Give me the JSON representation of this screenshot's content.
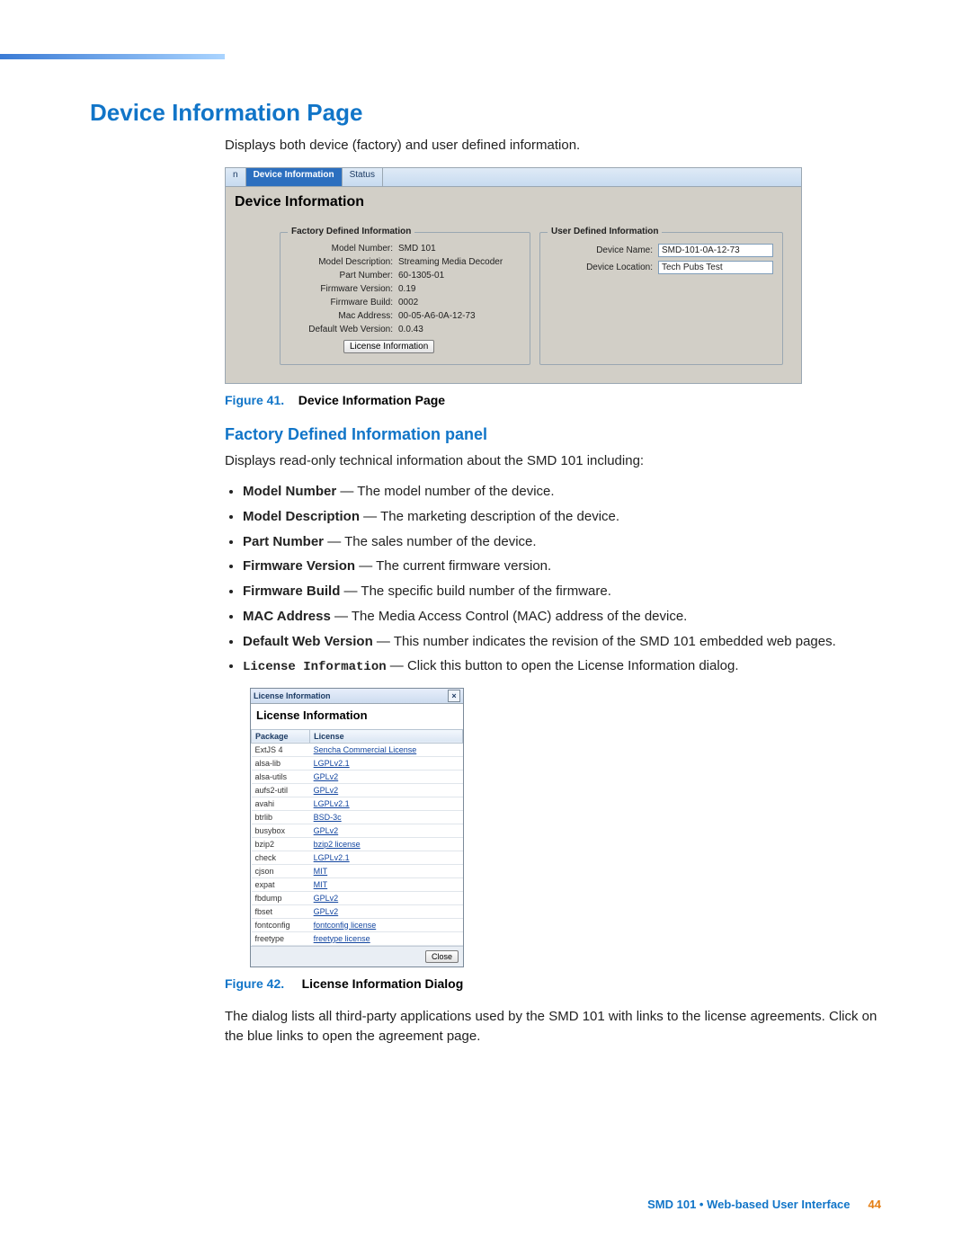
{
  "heading": "Device Information Page",
  "intro": "Displays both device (factory) and user defined information.",
  "fig41": {
    "label": "Figure 41.",
    "title": "Device Information Page"
  },
  "deviceInfo": {
    "tabs": {
      "stub": "n",
      "active": "Device Information",
      "other": "Status"
    },
    "panelTitle": "Device Information",
    "factory": {
      "legend": "Factory Defined Information",
      "rows": [
        {
          "k": "Model Number:",
          "v": "SMD 101"
        },
        {
          "k": "Model Description:",
          "v": "Streaming Media Decoder"
        },
        {
          "k": "Part Number:",
          "v": "60-1305-01"
        },
        {
          "k": "Firmware Version:",
          "v": "0.19"
        },
        {
          "k": "Firmware Build:",
          "v": "0002"
        },
        {
          "k": "Mac Address:",
          "v": "00-05-A6-0A-12-73"
        },
        {
          "k": "Default Web Version:",
          "v": "0.0.43"
        }
      ],
      "licenseBtn": "License Information"
    },
    "user": {
      "legend": "User Defined Information",
      "rows": [
        {
          "k": "Device Name:",
          "v": "SMD-101-0A-12-73"
        },
        {
          "k": "Device Location:",
          "v": "Tech Pubs Test"
        }
      ]
    }
  },
  "subsection": "Factory Defined Information panel",
  "subIntro": "Displays read-only technical information about the SMD 101 including:",
  "descList": [
    {
      "term": "Model Number",
      "desc": " — The model number of the device."
    },
    {
      "term": "Model Description",
      "desc": " — The marketing description of the device."
    },
    {
      "term": "Part Number",
      "desc": " — The sales number of the device."
    },
    {
      "term": "Firmware Version",
      "desc": " — The current firmware version."
    },
    {
      "term": "Firmware Build",
      "desc": " — The specific build number of the firmware."
    },
    {
      "term": "MAC Address",
      "desc": " — The Media Access Control (MAC) address of the device."
    },
    {
      "term": "Default Web Version",
      "desc": " — This number indicates the revision of the SMD 101 embedded web pages."
    },
    {
      "term": "License Information",
      "desc": " — Click this button to open the License Information dialog.",
      "mono": true
    }
  ],
  "licenseDialog": {
    "title": "License Information",
    "heading": "License Information",
    "headers": {
      "pkg": "Package",
      "lic": "License"
    },
    "rows": [
      {
        "pkg": "ExtJS 4",
        "lic": "Sencha Commercial License"
      },
      {
        "pkg": "alsa-lib",
        "lic": "LGPLv2.1"
      },
      {
        "pkg": "alsa-utils",
        "lic": "GPLv2"
      },
      {
        "pkg": "aufs2-util",
        "lic": "GPLv2"
      },
      {
        "pkg": "avahi",
        "lic": "LGPLv2.1"
      },
      {
        "pkg": "btrlib",
        "lic": "BSD-3c"
      },
      {
        "pkg": "busybox",
        "lic": "GPLv2"
      },
      {
        "pkg": "bzip2",
        "lic": "bzip2 license"
      },
      {
        "pkg": "check",
        "lic": "LGPLv2.1"
      },
      {
        "pkg": "cjson",
        "lic": "MIT"
      },
      {
        "pkg": "expat",
        "lic": "MIT"
      },
      {
        "pkg": "fbdump",
        "lic": "GPLv2"
      },
      {
        "pkg": "fbset",
        "lic": "GPLv2"
      },
      {
        "pkg": "fontconfig",
        "lic": "fontconfig license"
      },
      {
        "pkg": "freetype",
        "lic": "freetype license"
      }
    ],
    "close": "Close"
  },
  "fig42": {
    "label": "Figure 42.",
    "title": "License Information Dialog"
  },
  "dialogDesc": "The dialog lists all third-party applications used by the SMD 101 with links to the license agreements. Click on the blue links to open the agreement page.",
  "footer": {
    "product": "SMD 101",
    "bullet": " • ",
    "section": "Web-based User Interface",
    "pageNum": "44"
  }
}
